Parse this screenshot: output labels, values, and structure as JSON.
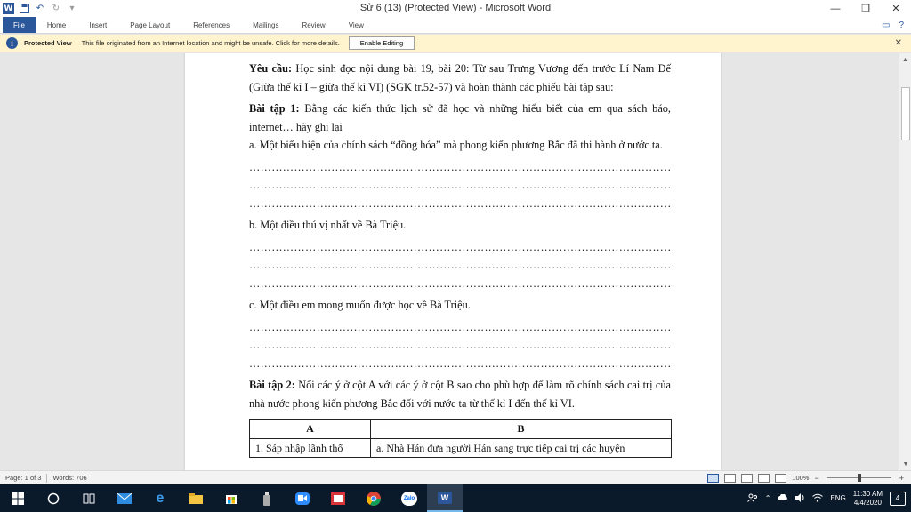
{
  "app": {
    "title": "Sử 6 (13) (Protected View) - Microsoft Word",
    "logo": "W"
  },
  "window_controls": {
    "minimize": "—",
    "maximize": "❐",
    "close": "✕"
  },
  "ribbon": {
    "tabs": [
      "File",
      "Home",
      "Insert",
      "Page Layout",
      "References",
      "Mailings",
      "Review",
      "View"
    ],
    "help": "?",
    "restore": "▭"
  },
  "protected_view": {
    "icon": "i",
    "title": "Protected View",
    "message": "This file originated from an Internet location and might be unsafe. Click for more details.",
    "button": "Enable Editing",
    "close": "✕"
  },
  "document": {
    "para1_bold": "Yêu cầu:",
    "para1_text": " Học sinh đọc nội dung bài 19, bài 20: Từ sau Trưng Vương đến trước Lí Nam Đế (Giữa thế kỉ I – giữa thế kỉ VI) (SGK tr.52-57) và hoàn thành các phiếu bài tập sau:",
    "ex1_bold": "Bài tập 1:",
    "ex1_text": " Bằng các kiến thức lịch sử đã học và những hiểu biết của em qua sách báo, internet… hãy ghi lại",
    "item_a": "a. Một biểu hiện của chính sách “đồng hóa” mà phong kiến phương Bắc đã thi hành ở nước ta.",
    "item_b": "b. Một điều thú vị nhất về Bà Triệu.",
    "item_c": "c. Một điều em mong muốn được học về Bà Triệu.",
    "dots": "……………………………………………………………………………………………………………………………",
    "ex2_bold": "Bài tập 2:",
    "ex2_text": " Nối các ý ở cột A với các ý ở cột B sao cho phù hợp để làm rõ chính sách cai trị của nhà nước phong kiến phương Bắc đối với nước ta từ thế kỉ I đến thế kỉ VI.",
    "table": {
      "headers": [
        "A",
        "B"
      ],
      "row1": [
        "1. Sáp nhập lãnh thổ",
        "a. Nhà Hán đưa người Hán sang trực tiếp cai trị các huyện"
      ]
    }
  },
  "status": {
    "page": "Page: 1 of 3",
    "words": "Words: 706",
    "zoom": "100%",
    "zoom_minus": "−",
    "zoom_plus": "+",
    "zoom_level": 100
  },
  "taskbar": {
    "language": "ENG",
    "time": "11:30 AM",
    "date": "4/4/2020",
    "notification_count": "4",
    "zalo": "Zalo",
    "word": "W",
    "edge": "e"
  }
}
